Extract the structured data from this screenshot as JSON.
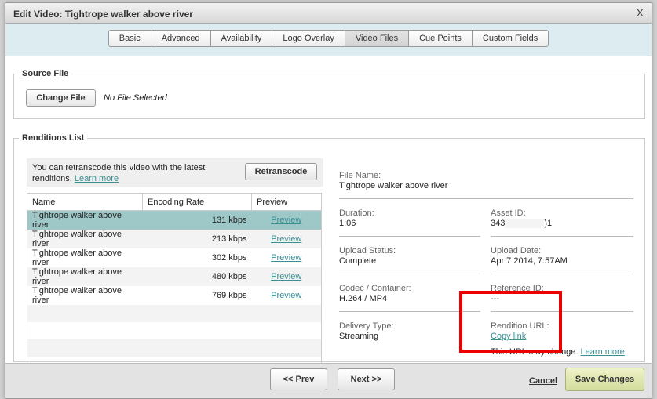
{
  "dialog": {
    "title": "Edit Video: Tightrope walker above river",
    "close": "X"
  },
  "tabs": [
    {
      "label": "Basic"
    },
    {
      "label": "Advanced"
    },
    {
      "label": "Availability"
    },
    {
      "label": "Logo Overlay"
    },
    {
      "label": "Video Files",
      "active": true
    },
    {
      "label": "Cue Points"
    },
    {
      "label": "Custom Fields"
    }
  ],
  "source": {
    "legend": "Source File",
    "button": "Change File",
    "status": "No File Selected"
  },
  "renditions": {
    "legend": "Renditions List",
    "note": "You can retranscode this video with the latest renditions.",
    "note_link": "Learn more",
    "retranscode": "Retranscode",
    "columns": [
      "Name",
      "Encoding Rate",
      "Preview"
    ],
    "rows": [
      {
        "name": "Tightrope walker above river",
        "rate": "131 kbps",
        "preview": "Preview",
        "selected": true
      },
      {
        "name": "Tightrope walker above river",
        "rate": "213 kbps",
        "preview": "Preview"
      },
      {
        "name": "Tightrope walker above river",
        "rate": "302 kbps",
        "preview": "Preview"
      },
      {
        "name": "Tightrope walker above river",
        "rate": "480 kbps",
        "preview": "Preview"
      },
      {
        "name": "Tightrope walker above river",
        "rate": "769 kbps",
        "preview": "Preview"
      }
    ]
  },
  "details": {
    "file_name": {
      "label": "File Name:",
      "value": "Tightrope walker above river"
    },
    "duration": {
      "label": "Duration:",
      "value": "1:06"
    },
    "asset_id": {
      "label": "Asset ID:",
      "value_start": "343",
      "value_end": ")1"
    },
    "upload_status": {
      "label": "Upload Status:",
      "value": "Complete"
    },
    "upload_date": {
      "label": "Upload Date:",
      "value": "Apr 7 2014, 7:57AM"
    },
    "codec": {
      "label": "Codec / Container:",
      "value": "H.264 / MP4"
    },
    "reference_id": {
      "label": "Reference ID:",
      "value": "---"
    },
    "delivery": {
      "label": "Delivery Type:",
      "value": "Streaming"
    },
    "rendition_url": {
      "label": "Rendition URL:",
      "link": "Copy link",
      "note": "This URL may change.",
      "note_link": "Learn more"
    }
  },
  "footer": {
    "prev": "<< Prev",
    "next": "Next >>",
    "cancel": "Cancel",
    "save": "Save Changes"
  },
  "colors": {
    "selected_row": "#9ec8c8",
    "link": "#3a8f95",
    "highlight": "#ee0000",
    "save": "#dfe6b0"
  }
}
